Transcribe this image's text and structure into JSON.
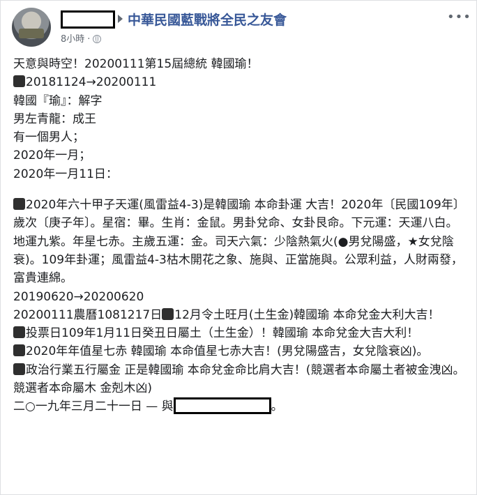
{
  "header": {
    "group_name": "中華民國藍戰將全民之友會",
    "timestamp": "8小時",
    "dot": "·",
    "more_icon": "more-dots-icon",
    "privacy_icon": "globe-icon",
    "more_label": "•••"
  },
  "post": {
    "line1": "天意與時空！20200111第15屆總統 韓國瑜！",
    "line2": "20181124→20200111",
    "line3": "韓國『瑜』：解字",
    "line4": "男左青龍：成王",
    "line5": "有一個男人；",
    "line6": "2020年一月；",
    "line7": "2020年一月11日：",
    "para1": "2020年六十甲子天運(風雷益4-3)是韓國瑜 本命卦運 大吉！2020年〔民國109年〕 歲次〔庚子年〕。星宿：畢。生肖：金鼠。男卦兌命、女卦艮命。下元運：天運八白。地運九紫。年星七赤。主歲五運：金。司天六氣：少陰熱氣火(●男兌陽盛，★女兌陰衰)。109年卦運；風雷益4-3枯木開花之象、施與、正當施與。公眾利益，人財兩發，富貴連綿。",
    "line8": "20190620→20200620",
    "para2a": "20200111農曆1081217日",
    "para2b": "12月令土旺月(土生金)韓國瑜 本命兌金大利大吉！",
    "para3": "投票日109年1月11日癸丑日屬土（土生金）！韓國瑜 本命兌金大吉大利！",
    "para4": "2020年年值星七赤 韓國瑜 本命值星七赤大吉！(男兌陽盛吉，女兌陰衰凶)。",
    "para5": "政治行業五行屬金 正是韓國瑜 本命兌金命比肩大吉！(競選者本命屬土者被金洩凶。競選者本命屬木 金剋木凶)",
    "closing_prefix": "二○一九年三月二十一日 — 與",
    "closing_suffix": "。"
  }
}
